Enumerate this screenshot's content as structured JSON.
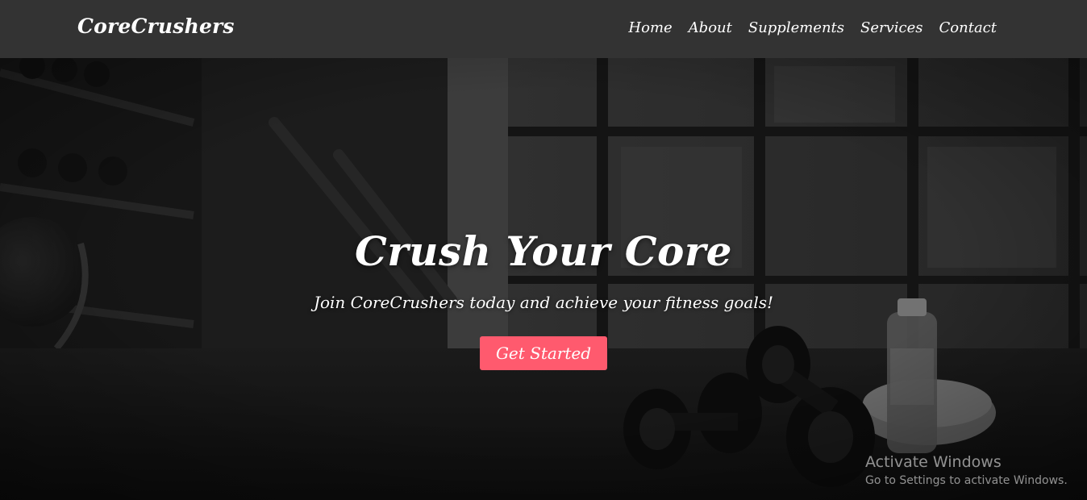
{
  "brand": "CoreCrushers",
  "nav": [
    "Home",
    "About",
    "Supplements",
    "Services",
    "Contact"
  ],
  "hero": {
    "title": "Crush Your Core",
    "subtitle": "Join CoreCrushers today and achieve your fitness goals!",
    "cta_label": "Get Started",
    "background": "gym-dumbbells-photo"
  },
  "watermark": {
    "title": "Activate Windows",
    "subtitle": "Go to Settings to activate Windows."
  },
  "colors": {
    "navbar": "#333333",
    "accent": "#ff5a6e"
  }
}
